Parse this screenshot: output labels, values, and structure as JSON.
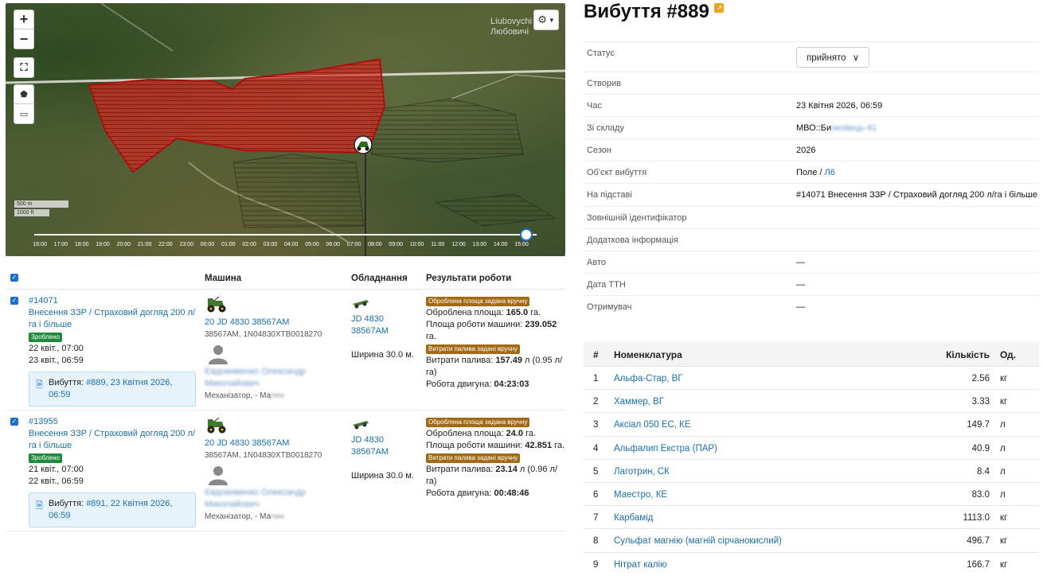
{
  "map": {
    "place_label": "Liubovychi\nЛюбовичі",
    "zoom_in": "+",
    "zoom_out": "−",
    "scale_m": "500 m",
    "scale_ft": "1000 ft",
    "timeline_ticks": [
      "16:00",
      "17:00",
      "18:00",
      "19:00",
      "20:00",
      "21:00",
      "22:00",
      "23:00",
      "00:00",
      "01:00",
      "02:00",
      "03:00",
      "04:00",
      "05:00",
      "06:00",
      "07:00",
      "08:00",
      "09:00",
      "10:00",
      "11:00",
      "12:00",
      "13:00",
      "14:00",
      "15:00"
    ],
    "timeline_position": 0.98
  },
  "work_table": {
    "headers": {
      "machine": "Машина",
      "equipment": "Обладнання",
      "results": "Результати роботи"
    },
    "rows": [
      {
        "id": "#14071",
        "operation": "Внесення ЗЗР / Страховий догляд 200 л/га і більше",
        "status": "Зроблено",
        "start": "22 квіт., 07:00",
        "end": "23 квіт., 06:59",
        "shipment_label": "Вибуття: ",
        "shipment_link": "#889, 23 Квітня 2026, 06:59",
        "machine_link": "20 JD 4830 38567АМ",
        "machine_sub": "38567АМ, 1N04830XTB0018270",
        "operator": "Євдокименко Олександр Миколайович",
        "operator_role": "Механізатор, - Ма",
        "operator_role_blur": "лин",
        "equipment_link": "JD 4830 38567АМ",
        "width": "Ширина 30.0 м.",
        "area_badge": "Оброблена площа задана вручну",
        "area_label": "Оброблена площа: ",
        "area_value": "165.0",
        "area_unit": " га.",
        "machine_area_label": "Площа роботи машини: ",
        "machine_area_value": "239.052",
        "machine_area_unit": " га.",
        "fuel_badge": "Витрати палива задані вручну",
        "fuel_label": "Витрати палива: ",
        "fuel_value": "157.49",
        "fuel_unit": " л (0.95 л/га)",
        "engine_label": "Робота двигуна: ",
        "engine_value": "04:23:03"
      },
      {
        "id": "#13955",
        "operation": "Внесення ЗЗР / Страховий догляд 200 л/га і більше",
        "status": "Зроблено",
        "start": "21 квіт., 07:00",
        "end": "22 квіт., 06:59",
        "shipment_label": "Вибуття: ",
        "shipment_link": "#891, 22 Квітня 2026, 06:59",
        "machine_link": "20 JD 4830 38567АМ",
        "machine_sub": "38567АМ, 1N04830XTB0018270",
        "operator": "Євдокименко Олександр Миколайович",
        "operator_role": "Механізатор, - Ма",
        "operator_role_blur": "лин",
        "equipment_link": "JD 4830 38567АМ",
        "width": "Ширина 30.0 м.",
        "area_badge": "Оброблена площа задана вручну",
        "area_label": "Оброблена площа: ",
        "area_value": "24.0",
        "area_unit": " га.",
        "machine_area_label": "Площа роботи машини: ",
        "machine_area_value": "42.851",
        "machine_area_unit": " га.",
        "fuel_badge": "Витрати палива задані вручну",
        "fuel_label": "Витрати палива: ",
        "fuel_value": "23.14",
        "fuel_unit": " л (0.96 л/га)",
        "engine_label": "Робота двигуна: ",
        "engine_value": "00:48:46"
      }
    ]
  },
  "doc": {
    "title": "Вибуття #889",
    "status_label": "Статус",
    "status_value": "прийнято",
    "created_label": "Створив",
    "time_label": "Час",
    "time_value": "23 Квітня 2026, 06:59",
    "warehouse_label": "Зі складу",
    "warehouse_value": "МВО::Би",
    "warehouse_blur": "нковець-41",
    "season_label": "Сезон",
    "season_value": "2026",
    "object_label": "Об'єкт вибуття",
    "object_value": "Поле / ",
    "object_link": "Л6",
    "basis_label": "На підставі",
    "basis_value": "#14071 Внесення ЗЗР / Страховий догляд 200 л/га і більше",
    "external_label": "Зовнішній ідентифікатор",
    "extra_label": "Додаткова інформація",
    "car_label": "Авто",
    "car_value": "—",
    "ttn_label": "Дата ТТН",
    "ttn_value": "—",
    "receiver_label": "Отримувач",
    "receiver_value": "—"
  },
  "nomenclature": {
    "headers": {
      "num": "#",
      "name": "Номенклатура",
      "qty": "Кількість",
      "unit": "Од."
    },
    "rows": [
      {
        "num": "1",
        "name": "Альфа-Стар, ВГ",
        "qty": "2.56",
        "unit": "кг"
      },
      {
        "num": "2",
        "name": "Хаммер, ВГ",
        "qty": "3.33",
        "unit": "кг"
      },
      {
        "num": "3",
        "name": "Аксіал 050 ЕС, КЕ",
        "qty": "149.7",
        "unit": "л"
      },
      {
        "num": "4",
        "name": "Альфалип Екстра (ПАР)",
        "qty": "40.9",
        "unit": "л"
      },
      {
        "num": "5",
        "name": "Лаготрин, СК",
        "qty": "8.4",
        "unit": "л"
      },
      {
        "num": "6",
        "name": "Маестро, КЕ",
        "qty": "83.0",
        "unit": "л"
      },
      {
        "num": "7",
        "name": "Карбамід",
        "qty": "1113.0",
        "unit": "кг"
      },
      {
        "num": "8",
        "name": "Сульфат магнію (магній сірчанокислий)",
        "qty": "496.7",
        "unit": "кг"
      },
      {
        "num": "9",
        "name": "Нітрат калію",
        "qty": "166.7",
        "unit": "кг"
      }
    ]
  },
  "colors": {
    "accent": "#1a6fb5",
    "done": "#1e8a3c",
    "warn": "#a36a16",
    "field": "#e8322c"
  }
}
